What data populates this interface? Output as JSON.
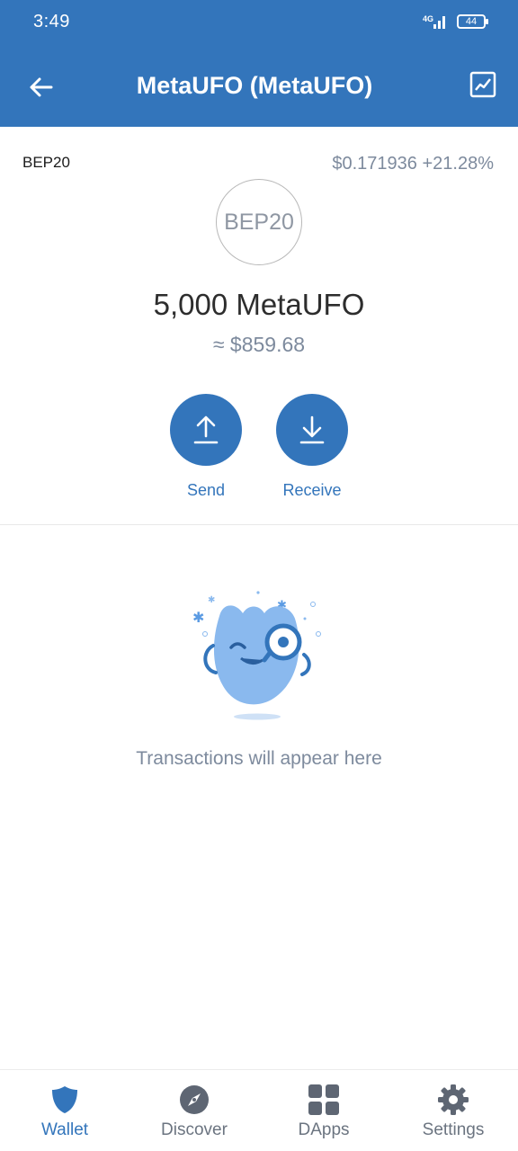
{
  "status_bar": {
    "time": "3:49",
    "network": "4G",
    "battery": "44"
  },
  "header": {
    "title": "MetaUFO (MetaUFO)",
    "back_icon": "arrow-left-icon",
    "chart_icon": "chart-icon"
  },
  "token": {
    "network": "BEP20",
    "price": "$0.171936",
    "change": "+21.28%",
    "logo_text": "BEP20",
    "balance": "5,000 MetaUFO",
    "fiat_value": "≈ $859.68"
  },
  "actions": {
    "send_label": "Send",
    "receive_label": "Receive"
  },
  "transactions": {
    "empty_message": "Transactions will appear here"
  },
  "tabs": [
    {
      "label": "Wallet",
      "icon": "shield-icon",
      "active": true
    },
    {
      "label": "Discover",
      "icon": "compass-icon",
      "active": false
    },
    {
      "label": "DApps",
      "icon": "grid-icon",
      "active": false
    },
    {
      "label": "Settings",
      "icon": "gear-icon",
      "active": false
    }
  ],
  "colors": {
    "primary": "#3375BB",
    "muted": "#7d8a9d",
    "mascot": "#8ab9ee"
  }
}
